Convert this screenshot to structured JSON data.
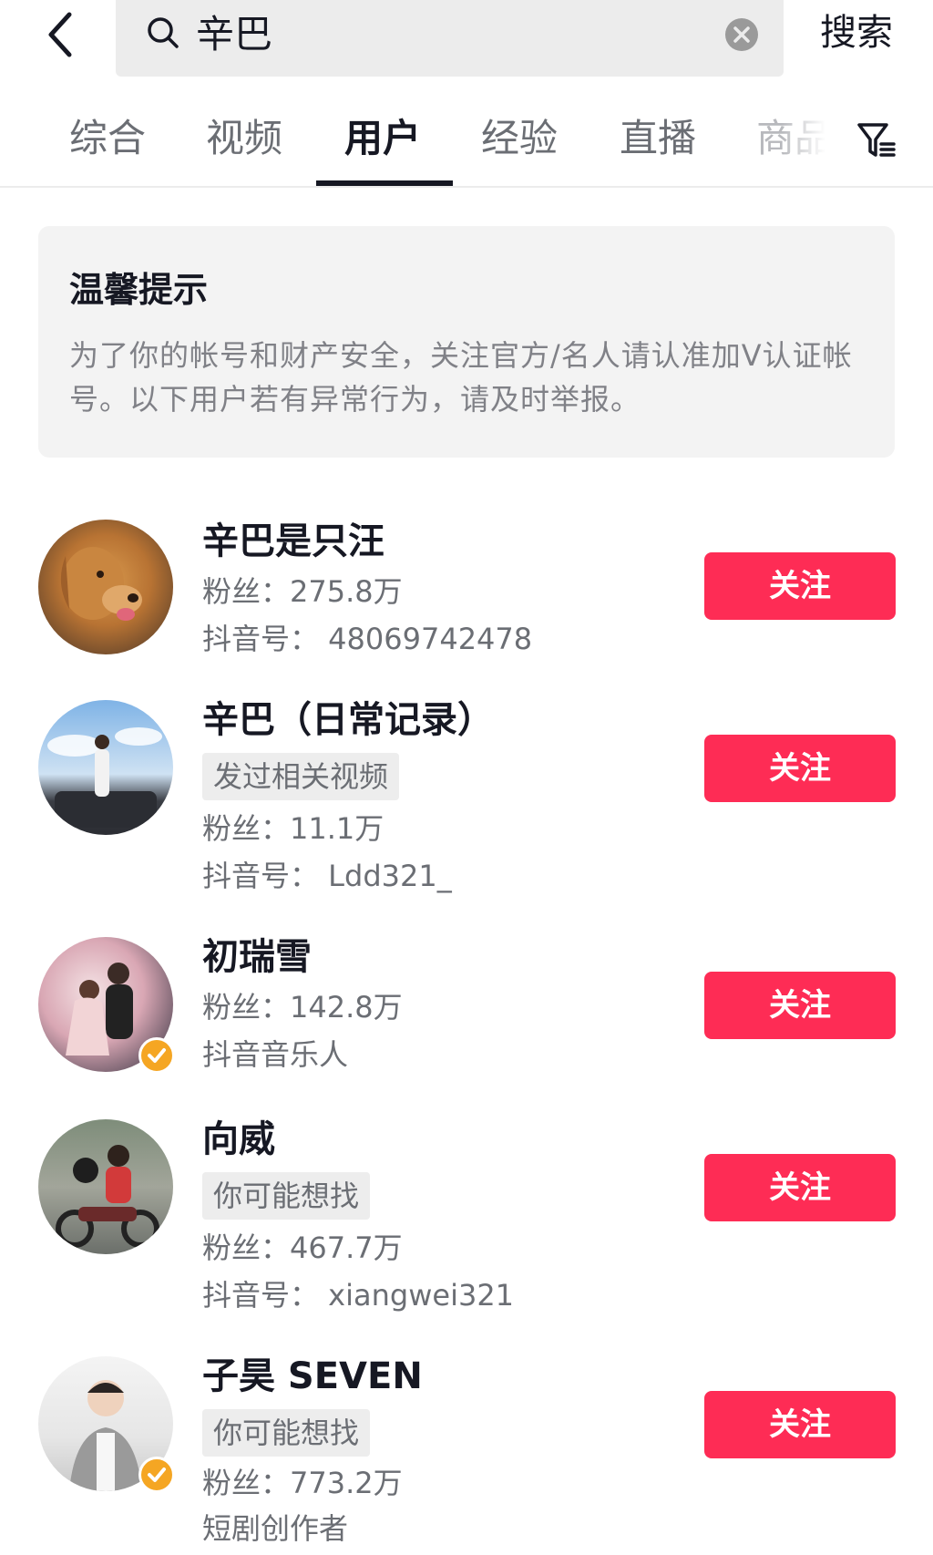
{
  "search": {
    "query": "辛巴",
    "button_label": "搜索"
  },
  "tabs": [
    {
      "label": "综合"
    },
    {
      "label": "视频"
    },
    {
      "label": "用户"
    },
    {
      "label": "经验"
    },
    {
      "label": "直播"
    },
    {
      "label": "商品"
    }
  ],
  "active_tab_index": 2,
  "notice": {
    "title": "温馨提示",
    "body": "为了你的帐号和财产安全，关注官方/名人请认准加V认证帐号。以下用户若有异常行为，请及时举报。"
  },
  "users": [
    {
      "name": "辛巴是只汪",
      "tag": "",
      "fans": "粉丝：275.8万",
      "extra": "抖音号：  48069742478",
      "follow_label": "关注",
      "verified": false
    },
    {
      "name": "辛巴（日常记录）",
      "tag": "发过相关视频",
      "fans": "粉丝：11.1万",
      "extra": "抖音号：  Ldd321_",
      "follow_label": "关注",
      "verified": false
    },
    {
      "name": "初瑞雪",
      "tag": "",
      "fans": "粉丝：142.8万",
      "extra": "抖音音乐人",
      "follow_label": "关注",
      "verified": true
    },
    {
      "name": "向威",
      "tag": "你可能想找",
      "fans": "粉丝：467.7万",
      "extra": "抖音号：  xiangwei321",
      "follow_label": "关注",
      "verified": false
    },
    {
      "name": "子昊 SEVEN",
      "tag": "你可能想找",
      "fans": "粉丝：773.2万",
      "extra": "短剧创作者",
      "follow_label": "关注",
      "verified": true
    }
  ],
  "colors": {
    "accent": "#fe2c55",
    "verified": "#f5a623",
    "text": "#161823",
    "muted": "#6b6e74"
  },
  "icons": {
    "back": "chevron-left-icon",
    "search": "search-icon",
    "clear": "clear-icon",
    "filter": "filter-icon"
  }
}
